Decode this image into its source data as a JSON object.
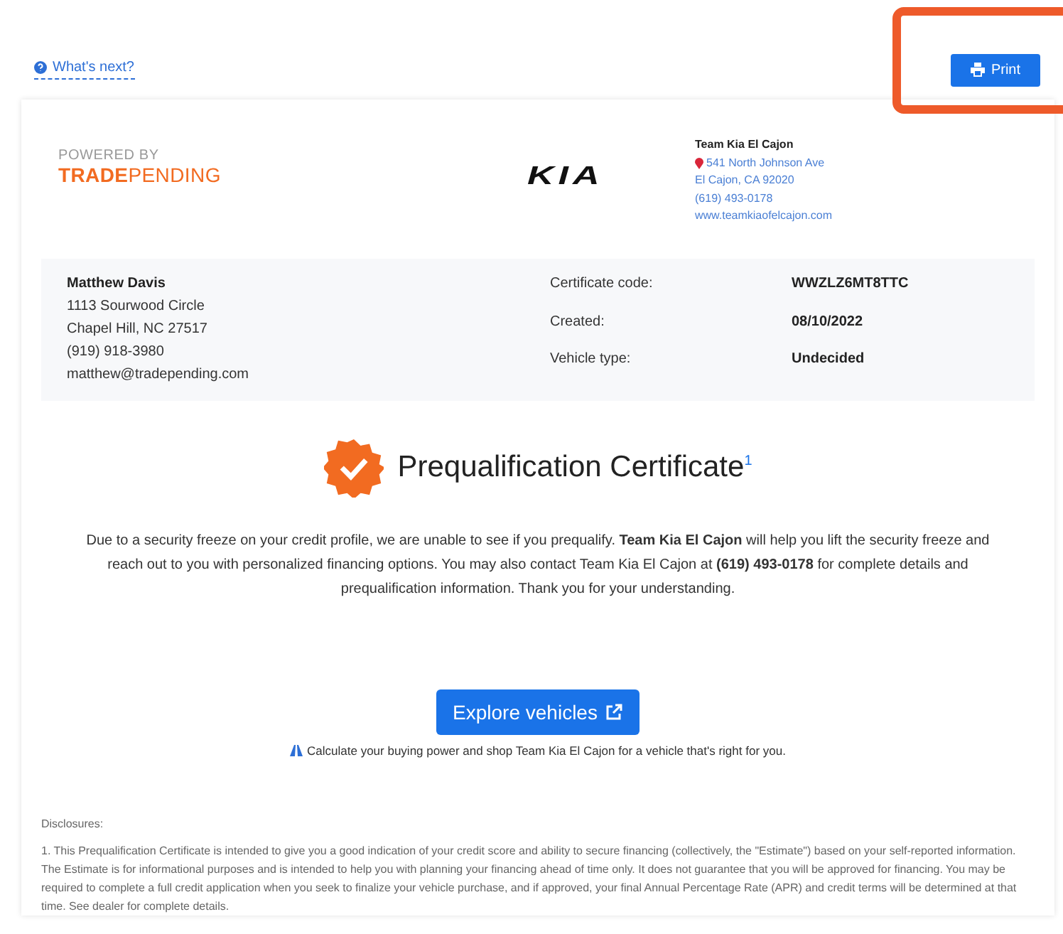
{
  "top_bar": {
    "help_link": "What's next?",
    "print_button": "Print",
    "highlighted": true
  },
  "header": {
    "powered_by": "POWERED BY",
    "brand_bold": "TRADE",
    "brand_light": "PENDING",
    "dealer_logo": "KIA",
    "dealer": {
      "name": "Team Kia El Cajon",
      "address": "541 North Johnson Ave",
      "city": "El Cajon, CA 92020",
      "phone": "(619) 493-0178",
      "website": "www.teamkiaofelcajon.com"
    }
  },
  "customer": {
    "name": "Matthew Davis",
    "lines": [
      "1113 Sourwood Circle",
      "Chapel Hill, NC 27517",
      "(919) 918-3980",
      "matthew@tradepending.com"
    ]
  },
  "details": [
    {
      "label": "Certificate code:",
      "value": "WWZLZ6MT8TTC"
    },
    {
      "label": "Created:",
      "value": "08/10/2022"
    },
    {
      "label": "Vehicle type:",
      "value": "Undecided"
    }
  ],
  "certificate": {
    "title": "Prequalification Certificate$^{1}$",
    "message": "Due to a security freeze on your credit profile, we are unable to see if you prequalify. **Team Kia El Cajon** will help you lift the security freeze and reach out to you with personalized financing options. You may also contact Team Kia El Cajon at **(619) 493-0178** for complete details and prequalification information. Thank you for your understanding.",
    "button": "Explore vehicles",
    "tagline": "Calculate your buying power and shop Team Kia El Cajon for a vehicle that's right for you."
  },
  "disclosures": {
    "heading": "Disclosures:",
    "text": "1. This Prequalification Certificate is intended to give you a good indication of your credit score and ability to secure financing (collectively, the \"Estimate\") based on your self-reported information. The Estimate is for informational purposes and is intended to help you with planning your financing ahead of time only. It does not guarantee that you will be approved for financing. You may be required to complete a full credit application when you seek to finalize your vehicle purchase, and if approved, your final Annual Percentage Rate (APR) and credit terms will be determined at that time. See dealer for complete details."
  }
}
